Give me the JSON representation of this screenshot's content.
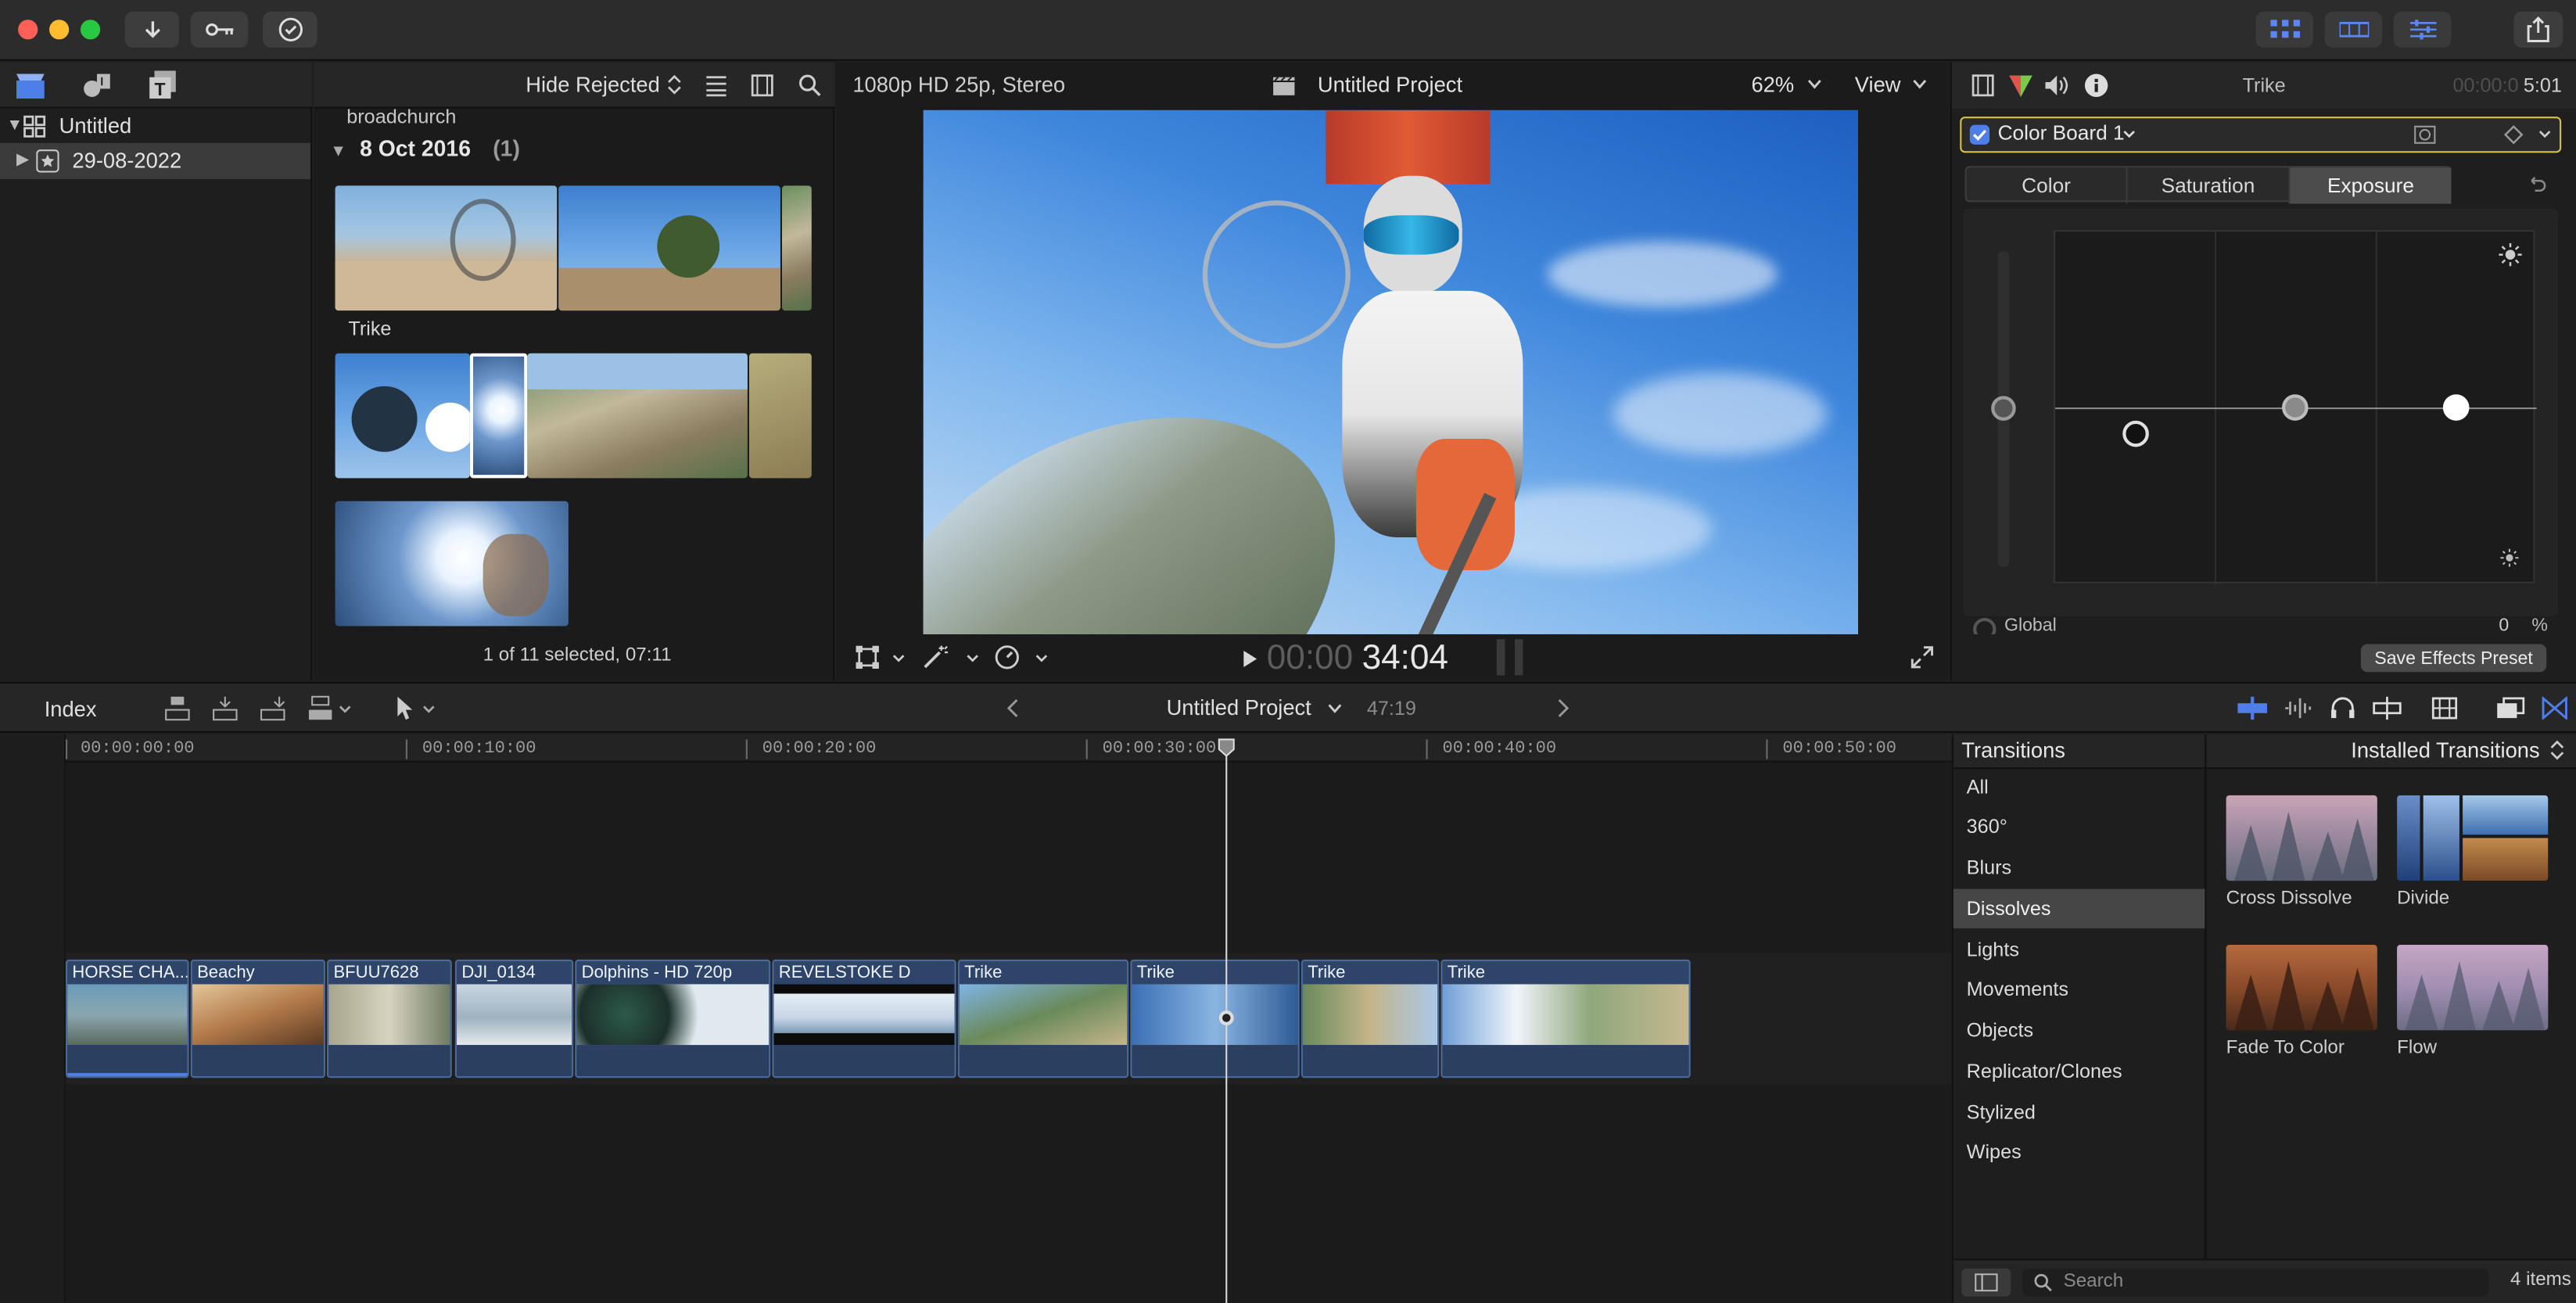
{
  "window": {
    "traffic_colors": [
      "#ff5f57",
      "#febc2e",
      "#28c840"
    ]
  },
  "library": {
    "root_label": "Untitled",
    "event_label": "29-08-2022"
  },
  "browser": {
    "filter_label": "Hide Rejected",
    "folder_label": "broadchurch",
    "date_group": "8 Oct 2016",
    "date_group_count": "(1)",
    "clip_label_trike": "Trike",
    "selection_status": "1 of 11 selected, 07:11"
  },
  "viewer": {
    "format_label": "1080p HD 25p, Stereo",
    "project_title": "Untitled Project",
    "zoom_label": "62%",
    "view_label": "View",
    "timecode_dim": "00:00",
    "timecode_main": "34:04"
  },
  "inspector": {
    "clip_name": "Trike",
    "timecode_dim": "00:00:0",
    "timecode_main": "5:01",
    "effect_name": "Color Board 1",
    "tabs": [
      "Color",
      "Saturation",
      "Exposure"
    ],
    "active_tab": "Exposure",
    "global_label": "Global",
    "global_value": "0",
    "global_unit": "%",
    "save_preset_label": "Save Effects Preset"
  },
  "timeline_bar": {
    "index_label": "Index",
    "project_title": "Untitled Project",
    "duration": "47:19"
  },
  "ruler": {
    "labels": [
      "00:00:00:00",
      "00:00:10:00",
      "00:00:20:00",
      "00:00:30:00",
      "00:00:40:00",
      "00:00:50:00"
    ]
  },
  "clips": [
    {
      "label": "HORSE CHA..."
    },
    {
      "label": "Beachy"
    },
    {
      "label": "BFUU7628"
    },
    {
      "label": "DJI_0134"
    },
    {
      "label": "Dolphins - HD 720p"
    },
    {
      "label": "REVELSTOKE D"
    },
    {
      "label": "Trike"
    },
    {
      "label": "Trike"
    },
    {
      "label": "Trike"
    },
    {
      "label": "Trike"
    }
  ],
  "transitions": {
    "title": "Transitions",
    "source_label": "Installed Transitions",
    "categories": [
      "All",
      "360°",
      "Blurs",
      "Dissolves",
      "Lights",
      "Movements",
      "Objects",
      "Replicator/Clones",
      "Stylized",
      "Wipes"
    ],
    "selected_category": "Dissolves",
    "items": [
      {
        "name": "Cross Dissolve"
      },
      {
        "name": "Divide"
      },
      {
        "name": "Fade To Color"
      },
      {
        "name": "Flow"
      }
    ],
    "search_placeholder": "Search",
    "count_label": "4 items"
  },
  "colors": {
    "accent_blue": "#4e7ee8",
    "clip_blue": "#2e4468",
    "effect_yellow": "#d6c04a"
  }
}
